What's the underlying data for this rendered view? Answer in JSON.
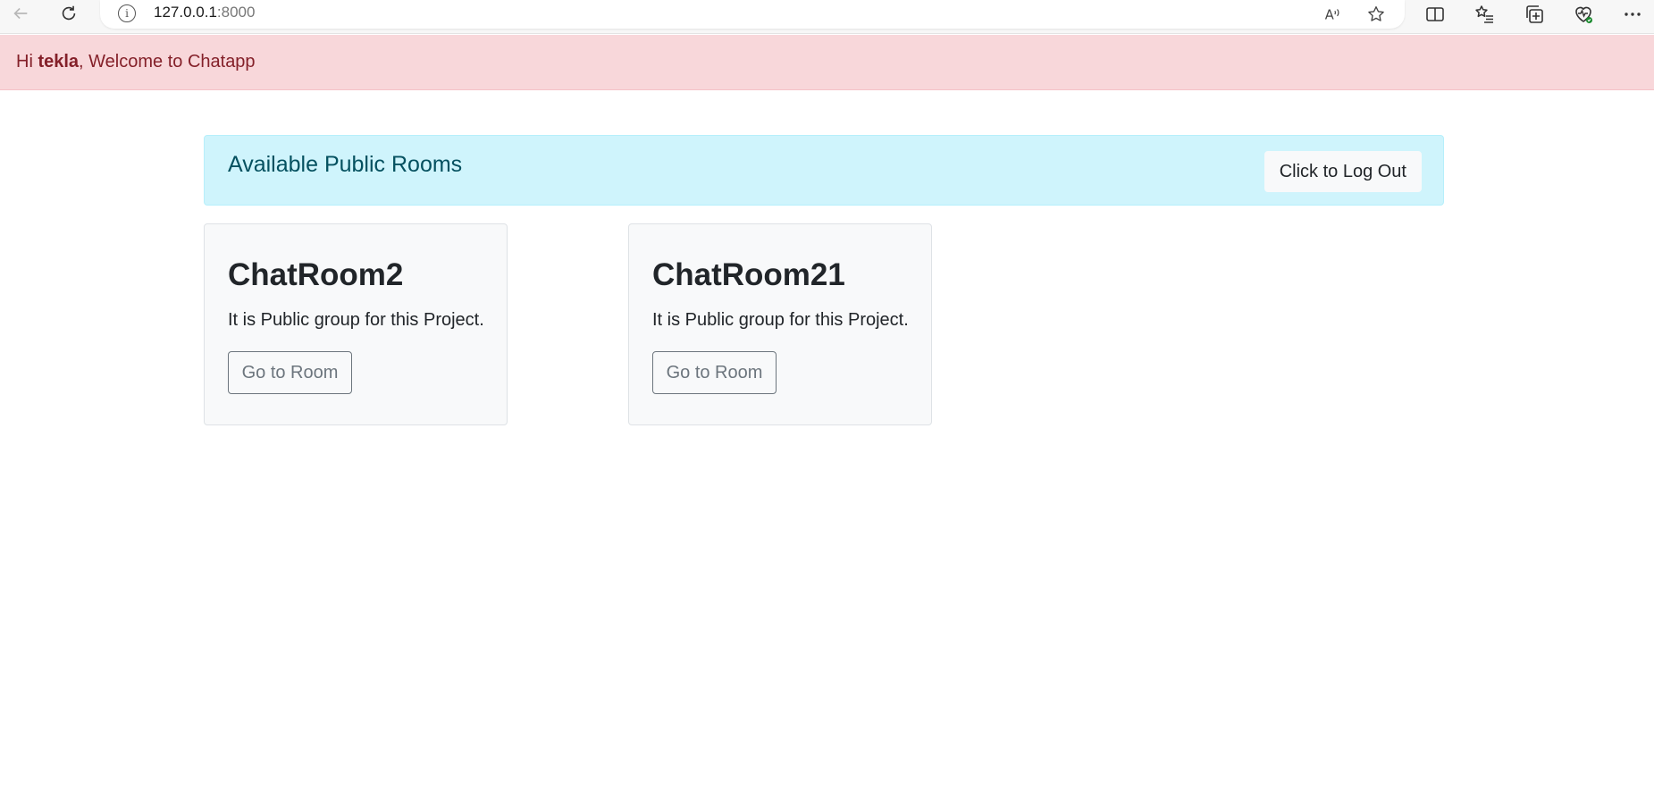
{
  "browser": {
    "url_host": "127.0.0.1",
    "url_port": ":8000",
    "icons": [
      "back-arrow-icon",
      "refresh-icon",
      "info-icon",
      "read-aloud-icon",
      "favorite-star-icon",
      "split-screen-icon",
      "favorites-list-icon",
      "collections-icon",
      "browser-essentials-icon",
      "more-menu-icon"
    ],
    "info_glyph": "i",
    "read_aloud_glyph": "A"
  },
  "welcome": {
    "prefix": "Hi ",
    "username": "tekla",
    "suffix": ", Welcome to Chatapp"
  },
  "rooms_header": {
    "title": "Available Public Rooms",
    "logout_label": "Click to Log Out"
  },
  "rooms": [
    {
      "name": "ChatRoom2",
      "description": "It is Public group for this Project.",
      "button_label": "Go to Room"
    },
    {
      "name": "ChatRoom21",
      "description": "It is Public group for this Project.",
      "button_label": "Go to Room"
    }
  ],
  "colors": {
    "alert_bg": "#f8d7da",
    "alert_text": "#842029",
    "info_bg": "#cff4fc",
    "info_text": "#055160",
    "card_bg": "#f8f9fa",
    "secondary": "#6c757d"
  }
}
